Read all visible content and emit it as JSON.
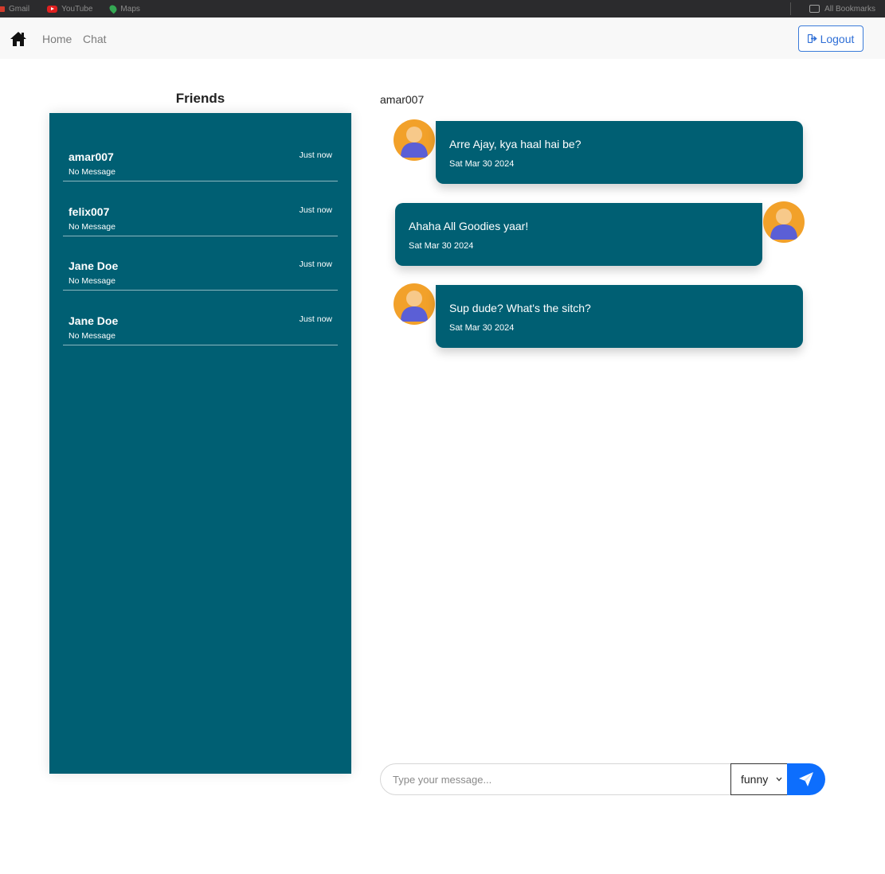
{
  "bookmarks": {
    "items": [
      {
        "label": "Gmail",
        "icon": "gmail-icon"
      },
      {
        "label": "YouTube",
        "icon": "youtube-icon"
      },
      {
        "label": "Maps",
        "icon": "maps-icon"
      }
    ],
    "all_bookmarks": "All Bookmarks"
  },
  "nav": {
    "home_icon": "home-icon",
    "links": [
      "Home",
      "Chat"
    ],
    "logout_label": "Logout",
    "logout_color": "#2f6fd6"
  },
  "friends": {
    "title": "Friends",
    "panel_color": "#005f73",
    "items": [
      {
        "name": "amar007",
        "message": "No Message",
        "time": "Just now"
      },
      {
        "name": "felix007",
        "message": "No Message",
        "time": "Just now"
      },
      {
        "name": "Jane Doe",
        "message": "No Message",
        "time": "Just now"
      },
      {
        "name": "Jane Doe",
        "message": "No Message",
        "time": "Just now"
      }
    ]
  },
  "chat": {
    "active_user": "amar007",
    "messages": [
      {
        "text": "Arre Ajay, kya haal hai be?",
        "date": "Sat Mar 30 2024",
        "side": "left"
      },
      {
        "text": "Ahaha All Goodies yaar!",
        "date": "Sat Mar 30 2024",
        "side": "right"
      },
      {
        "text": "Sup dude? What's the sitch?",
        "date": "Sat Mar 30 2024",
        "side": "left"
      }
    ]
  },
  "composer": {
    "placeholder": "Type your message...",
    "mood_selected": "funny",
    "send_icon": "paper-plane-icon",
    "send_color": "#0d6efd"
  }
}
